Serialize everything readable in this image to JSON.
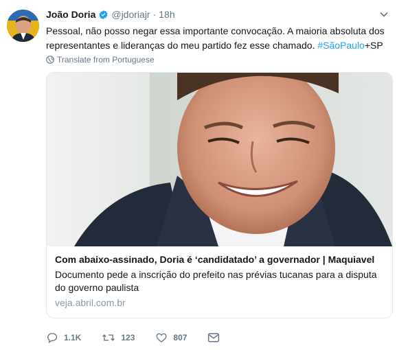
{
  "tweet": {
    "name": "João Doria",
    "handle": "@jdoriajr",
    "separator": "·",
    "time": "18h",
    "text_main": "Pessoal, não posso negar essa importante convocação. A maioria absoluta dos representantes e lideranças do meu partido fez esse chamado. ",
    "hashtag": "#SãoPaulo",
    "text_tail": "+SP",
    "translate_label": "Translate from Portuguese"
  },
  "card": {
    "title": "Com abaixo-assinado, Doria é ‘candidatado’ a governador | Maquiavel",
    "description": "Documento pede a inscrição do prefeito nas prévias tucanas para a disputa do governo paulista",
    "domain": "veja.abril.com.br"
  },
  "actions": {
    "replies": "1.1K",
    "retweets": "123",
    "likes": "807"
  },
  "colors": {
    "accent": "#1da1f2",
    "muted": "#657786",
    "border": "#e1e8ed"
  },
  "icons": [
    "verified-icon",
    "chevron-down-icon",
    "globe-icon",
    "reply-icon",
    "retweet-icon",
    "like-icon",
    "message-icon"
  ]
}
